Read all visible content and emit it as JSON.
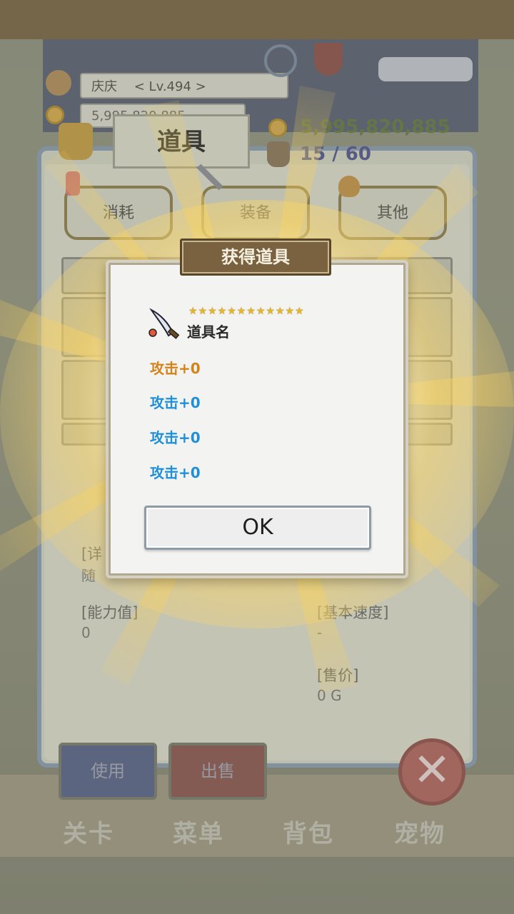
{
  "hud": {
    "player_name": "庆庆",
    "level": "< Lv.494 >",
    "gold_small": "5,995,820,885",
    "gold": "5,995,820,885",
    "bag_count": "15 / 60",
    "bag_count_color": "#5b5f8a",
    "gold_color": "#6b7a4a"
  },
  "inventory": {
    "title": "道具",
    "tabs": [
      {
        "label": "消耗",
        "icon": "potion-icon"
      },
      {
        "label": "装备",
        "icon": "sword-icon"
      },
      {
        "label": "其他",
        "icon": "bag-icon"
      }
    ],
    "detail_label": "[详",
    "detail_text": "随",
    "ability_label": "[能力值]",
    "ability_value": "0",
    "speed_label": "[基本速度]",
    "speed_value": "-",
    "price_label": "[售价]",
    "price_value": "0 G",
    "use_label": "使用",
    "sell_label": "出售"
  },
  "nav": {
    "items": [
      "关卡",
      "菜单",
      "背包",
      "宠物"
    ]
  },
  "dialog": {
    "title": "获得道具",
    "stars": "★★★★★★★★★★★★",
    "item_name": "道具名",
    "item_icon": "weapon-icon",
    "attributes": [
      {
        "text": "攻击+0",
        "color": "#d4831a"
      },
      {
        "text": "攻击+0",
        "color": "#1f8fd8"
      },
      {
        "text": "攻击+0",
        "color": "#1f8fd8"
      },
      {
        "text": "攻击+0",
        "color": "#1f8fd8"
      }
    ],
    "ok_label": "OK"
  },
  "colors": {
    "glow": "#f7d56b",
    "dialog_bg": "#f3f3f1",
    "title_bg": "#7a6240"
  }
}
